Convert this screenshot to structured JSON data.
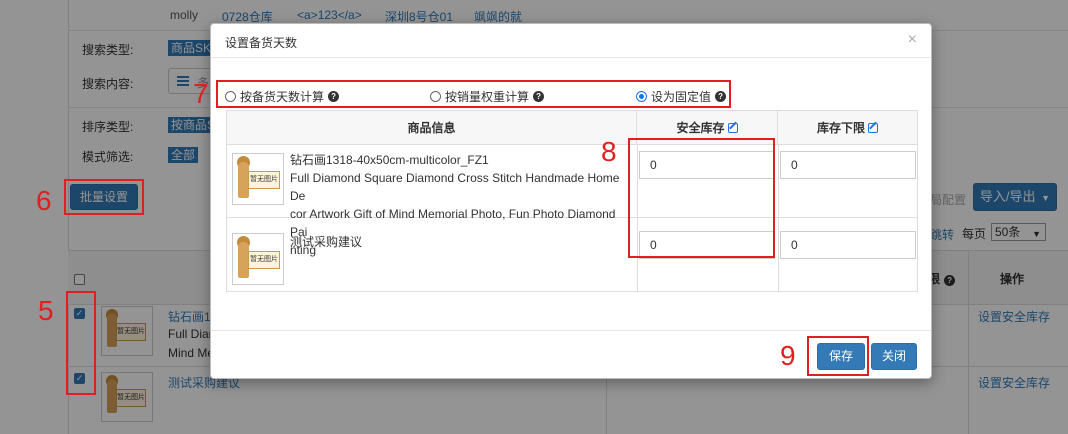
{
  "background": {
    "top_row": [
      "molly",
      "0728仓库",
      "<a>123</a>",
      "深圳8号仓01",
      "飒飒的就"
    ],
    "filters": {
      "search_type_label": "搜索类型:",
      "search_type_value": "商品SKU",
      "search_content_label": "搜索内容:",
      "search_content_placeholder": "多",
      "sort_type_label": "排序类型:",
      "sort_type_value": "按商品SKU",
      "mode_filter_label": "模式筛选:",
      "mode_filter_value": "全部"
    },
    "bulk_settings_button": "批量设置",
    "import_export_button": "导入/导出",
    "config_text": "局配置",
    "jump_text": "跳转",
    "page_size_label": "每页",
    "page_size_value": "50条",
    "table": {
      "limit_header": "限",
      "ops_header": "操作",
      "rows": [
        {
          "link": "钻石画1",
          "line2": "Full Diar",
          "line3": "Mind Me",
          "op": "设置安全库存"
        },
        {
          "link": "测试采购建议",
          "op": "设置安全库存"
        }
      ]
    }
  },
  "modal": {
    "title": "设置备货天数",
    "close": "×",
    "options": [
      {
        "label": "按备货天数计算",
        "selected": false
      },
      {
        "label": "按销量权重计算",
        "selected": false
      },
      {
        "label": "设为固定值",
        "selected": true
      }
    ],
    "columns": {
      "product": "商品信息",
      "safety": "安全库存",
      "min": "库存下限"
    },
    "rows": [
      {
        "name_lines": [
          "钻石画1318-40x50cm-multicolor_FZ1",
          "Full Diamond Square Diamond Cross Stitch Handmade Home De",
          "cor Artwork Gift of Mind Memorial Photo, Fun Photo Diamond Pai",
          "nting"
        ],
        "safety": "0",
        "min": "0"
      },
      {
        "name_lines": [
          "测试采购建议"
        ],
        "safety": "0",
        "min": "0"
      }
    ],
    "no_image_text": "暂无图片",
    "save": "保存",
    "close_button": "关闭"
  },
  "annotations": {
    "n5": "5",
    "n6": "6",
    "n7": "7",
    "n8": "8",
    "n9": "9"
  },
  "colors": {
    "primary": "#337ab7",
    "annotation": "#e02020",
    "radio": "#1a73e8"
  }
}
